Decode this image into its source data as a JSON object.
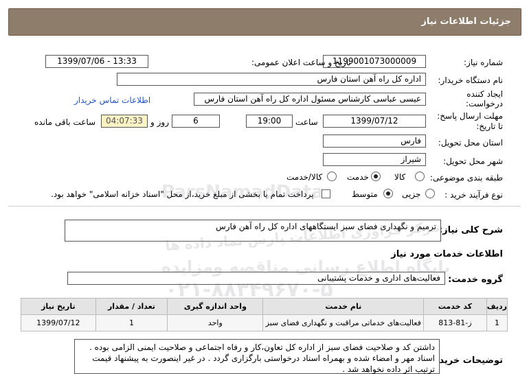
{
  "header": {
    "title": "جزئیات اطلاعات نیاز"
  },
  "fields": {
    "need_number_label": "شماره نیاز:",
    "need_number": "1199001073000009",
    "announce_label": "تاریخ و ساعت اعلان عمومی:",
    "announce_value": "1399/07/06 - 13:33",
    "buyer_label": "نام دستگاه خریدار:",
    "buyer_value": "اداره کل راه آهن استان فارس",
    "creator_label_1": "ایجاد کننده",
    "creator_label_2": "درخواست:",
    "creator_value": "عیسی عباسی کارشناس مسئول اداره کل راه آهن استان فارس",
    "contact_link": "اطلاعات تماس خریدار",
    "deadline_label_1": "مهلت ارسال پاسخ:",
    "deadline_label_2": "تا تاریخ:",
    "deadline_date": "1399/07/12",
    "time_label": "ساعت",
    "deadline_time": "19:00",
    "days_value": "6",
    "days_label": "روز و",
    "remaining_time": "04:07:33",
    "remaining_label": "ساعت باقی مانده",
    "province_label": "استان محل تحویل:",
    "province_value": "فارس",
    "city_label": "شهر محل تحویل:",
    "city_value": "شیراز",
    "category_label": "طبقه بندی موضوعی:",
    "category_options": [
      "کالا",
      "خدمت",
      "کالا/خدمت"
    ],
    "category_selected": "خدمت",
    "process_label": "نوع فرآیند خرید :",
    "process_options": [
      "جزیی",
      "متوسط"
    ],
    "process_selected": "متوسط",
    "payment_note": "پرداخت تمام یا بخشی از مبلغ خرید،از محل \"اسناد خزانه اسلامی\" خواهد بود."
  },
  "summary": {
    "label": "شرح کلی نیاز:",
    "value": "ترمیم و نگهداری فضای سبز ایستگاههای اداره کل راه آهن فارس"
  },
  "services_section": {
    "title": "اطلاعات خدمات مورد نیاز",
    "group_label": "گروه خدمت:",
    "group_value": "فعالیت‌های اداری و خدمات پشتیبانی"
  },
  "table": {
    "headers": [
      "ردیف",
      "کد خدمت",
      "نام خدمت",
      "واحد اندازه گیری",
      "تعداد / مقدار",
      "تاریخ نیاز"
    ],
    "rows": [
      [
        "1",
        "ز-81-813",
        "فعالیت‌های خدماتی مراقبت و نگهداری فضای سبز",
        "واحد",
        "1",
        "1399/07/12"
      ]
    ]
  },
  "notes": {
    "label": "توضیحات خریدار:",
    "line1": "داشتن کد و صلاحیت فضای سبز از اداره کل تعاون،کار و رفاه اجتماعی و صلاحیت ایمنی الزامی بوده .",
    "line2": "اسناد مهر و امضاء شده و بهمراه اسناد درخواستی بارگزاری گردد . در غیر اینصورت به پیشنهاد قیمت",
    "line3": "ترتیب اثر داده نخواهد شد ."
  },
  "watermark": {
    "brand": "ParsNamadData",
    "line1": "مرکز فراوری اطلاعات پارس نماد داده ها",
    "line2": "پایگاه اطلاع رسانی مناقصه ومزایده",
    "phone": "۰۲۱-۸۸۳۴۹۶۷۰-۵"
  },
  "colors": {
    "header_bg": "#8e7d6b",
    "link": "#2255cc",
    "remaining_bg": "#fbf3c4"
  }
}
